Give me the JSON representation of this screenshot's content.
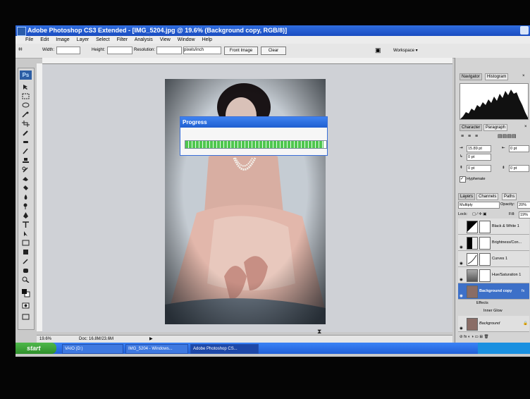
{
  "window": {
    "title": "Adobe Photoshop CS3 Extended - [IMG_5204.jpg @ 19.6% (Background copy, RGB/8)]"
  },
  "menubar": {
    "items": [
      "File",
      "Edit",
      "Image",
      "Layer",
      "Select",
      "Filter",
      "Analysis",
      "View",
      "Window",
      "Help"
    ]
  },
  "options": {
    "width_label": "Width:",
    "height_label": "Height:",
    "resolution_label": "Resolution:",
    "units_value": "pixels/inch",
    "front_image_label": "Front Image",
    "clear_label": "Clear",
    "workspace_label": "Workspace ▾"
  },
  "toolbox": {
    "logo": "Ps"
  },
  "progress_dialog": {
    "title": "Progress",
    "progress": 0.98
  },
  "status": {
    "zoom": "19.6%",
    "doc": "Doc: 16.8M/23.6M"
  },
  "panels": {
    "navigator_tab": "Navigator",
    "histogram_tab": "Histogram",
    "character_tab": "Character",
    "paragraph_tab": "Paragraph",
    "indent_left": "15.89 pt",
    "indent_right": "0 pt",
    "first_line": "0 pt",
    "space_before": "0 pt",
    "space_after": "0 pt",
    "hyphenate": "Hyphenate",
    "layers_tab": "Layers",
    "channels_tab": "Channels",
    "paths_tab": "Paths",
    "blend_mode": "Multiply",
    "opacity_label": "Opacity:",
    "opacity_value": "20%",
    "lock_label": "Lock:",
    "fill_label": "Fill:",
    "fill_value": "19%",
    "layers": [
      "Black & White 1",
      "Brightness/Con...",
      "Curves 1",
      "Hue/Saturation 1",
      "Background copy",
      "Background"
    ],
    "effects_label": "Effects",
    "inner_glow_label": "Inner Glow"
  },
  "taskbar": {
    "start": "start",
    "tasks": [
      "VAIO (D:)",
      "IMG_5204 - Windows...",
      "Adobe Photoshop CS..."
    ]
  },
  "colors": {
    "accent": "#2f6de0",
    "selected_layer": "#3d70c8",
    "progress": "#4fc74f"
  }
}
